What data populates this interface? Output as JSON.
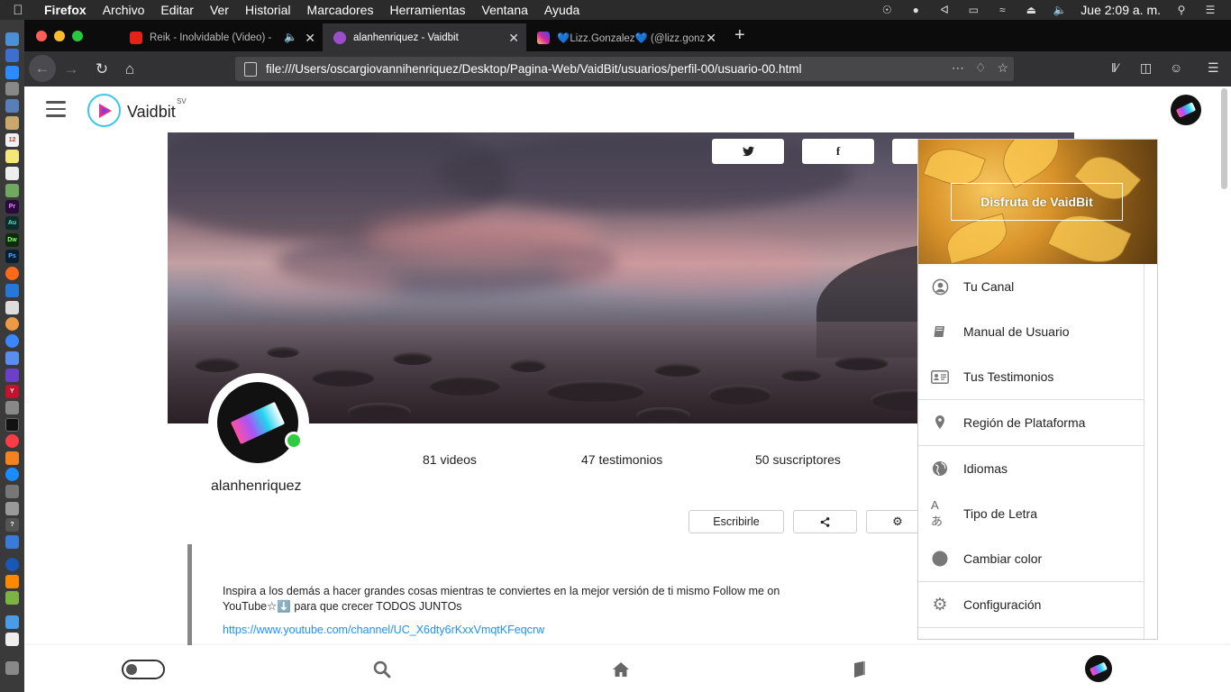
{
  "menubar": {
    "app": "Firefox",
    "items": [
      "Archivo",
      "Editar",
      "Ver",
      "Historial",
      "Marcadores",
      "Herramientas",
      "Ventana",
      "Ayuda"
    ],
    "clock": "Jue 2:09 a. m."
  },
  "tabs": [
    {
      "title": "Reik - Inolvidable (Video) -",
      "favicon_color": "#e62117"
    },
    {
      "title": "alanhenriquez - Vaidbit",
      "favicon_color": "#9b4dca"
    },
    {
      "title": "💙Lizz.Gonzalez💙 (@lizz.gonz",
      "favicon_color": "#d6249f"
    }
  ],
  "url": "file:///Users/oscargiovannihenriquez/Desktop/Pagina-Web/VaidBit/usuarios/perfil-00/usuario-00.html",
  "header": {
    "brand": "Vaidbit",
    "brand_suffix": "SV"
  },
  "profile": {
    "username": "alanhenriquez",
    "stats": {
      "videos": "81 videos",
      "testimonios": "47 testimonios",
      "suscriptores": "50 suscriptores"
    },
    "buttons": {
      "write": "Escribirle"
    },
    "bio": "Inspira a los demás a hacer grandes cosas mientras te conviertes en la mejor versión de ti mismo Follow me on YouTube☆⬇️ para que crecer TODOS JUNTOs",
    "bio_link": "https://www.youtube.com/channel/UC_X6dty6rKxxVmqtKFeqcrw"
  },
  "dropdown": {
    "cta": "Disfruta de VaidBit",
    "items": [
      {
        "label": "Tu Canal",
        "icon": "user-circle-icon"
      },
      {
        "label": "Manual de Usuario",
        "icon": "book-icon"
      },
      {
        "label": "Tus Testimonios",
        "icon": "id-card-icon"
      },
      {
        "label": "Región de Plataforma",
        "icon": "location-pin-icon"
      },
      {
        "label": "Idiomas",
        "icon": "globe-icon"
      },
      {
        "label": "Tipo de Letra",
        "icon": "font-translate-icon"
      },
      {
        "label": "Cambiar color",
        "icon": "color-circle-icon"
      },
      {
        "label": "Configuración",
        "icon": "gear-icon"
      }
    ]
  },
  "colors": {
    "accent": "#3ac8e8",
    "online": "#2ecc40",
    "link": "#1e90ff"
  }
}
